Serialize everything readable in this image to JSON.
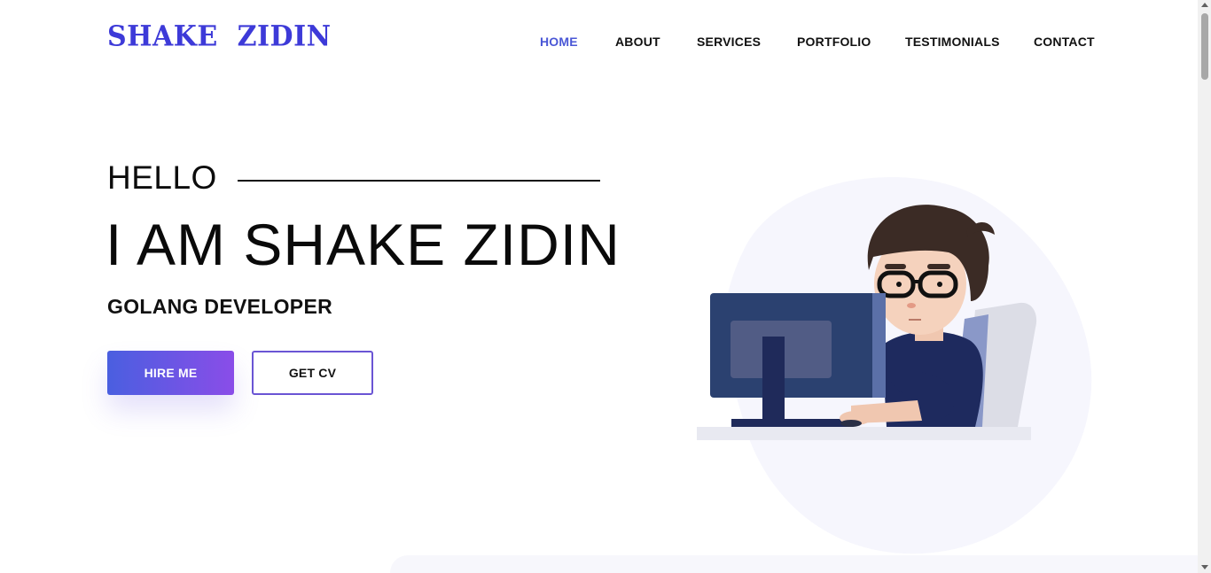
{
  "brand": {
    "logo_text": "SHAKE  ZIDIN",
    "color": "#3d3ad8"
  },
  "nav": {
    "items": [
      {
        "label": "HOME",
        "active": true
      },
      {
        "label": "ABOUT",
        "active": false
      },
      {
        "label": "SERVICES",
        "active": false
      },
      {
        "label": "PORTFOLIO",
        "active": false
      },
      {
        "label": "TESTIMONIALS",
        "active": false
      },
      {
        "label": "CONTACT",
        "active": false
      }
    ],
    "active_color": "#4a57d6"
  },
  "hero": {
    "greeting": "HELLO",
    "title": "I AM SHAKE ZIDIN",
    "subtitle": "GOLANG DEVELOPER",
    "hire_button": "HIRE ME",
    "cv_button": "GET CV",
    "gradient_start": "#4a5fe0",
    "gradient_end": "#8a4de8"
  },
  "illustration": {
    "icon": "developer-at-computer-illustration"
  }
}
